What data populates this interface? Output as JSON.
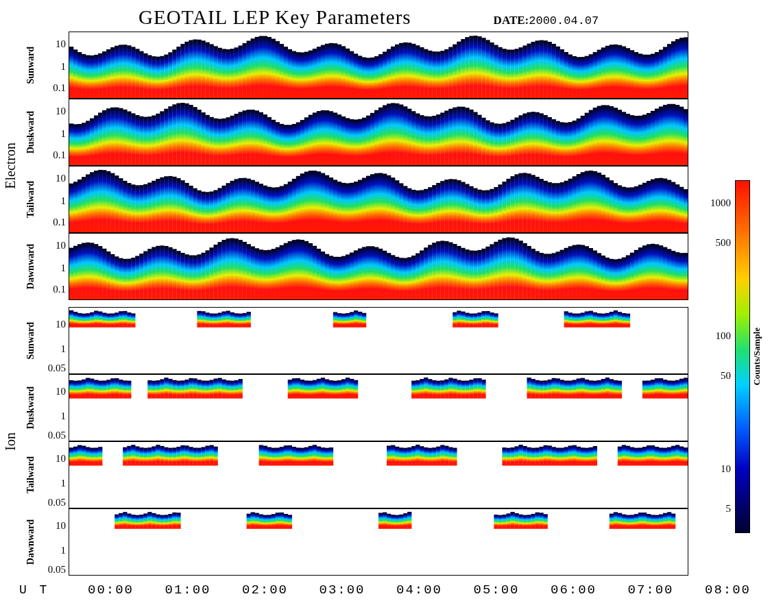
{
  "title": "GEOTAIL LEP Key Parameters",
  "date": {
    "label": "DATE:",
    "value": "2000.04.07"
  },
  "groups": [
    {
      "species": "Electron",
      "kind": "electron",
      "panels": [
        {
          "direction": "Sunward",
          "yticks": [
            "10",
            "1",
            "0.1"
          ]
        },
        {
          "direction": "Duskward",
          "yticks": [
            "10",
            "1",
            "0.1"
          ]
        },
        {
          "direction": "Tailward",
          "yticks": [
            "10",
            "1",
            "0.1"
          ]
        },
        {
          "direction": "Dawnward",
          "yticks": [
            "10",
            "1",
            "0.1"
          ]
        }
      ]
    },
    {
      "species": "Ion",
      "kind": "ion",
      "panels": [
        {
          "direction": "Sunward",
          "yticks": [
            "10",
            "1",
            "0.05"
          ]
        },
        {
          "direction": "Duskward",
          "yticks": [
            "10",
            "1",
            "0.05"
          ]
        },
        {
          "direction": "Tailward",
          "yticks": [
            "10",
            "1",
            "0.05"
          ]
        },
        {
          "direction": "Dawnward",
          "yticks": [
            "10",
            "1",
            "0.05"
          ]
        }
      ]
    }
  ],
  "x_axis": {
    "label": "U T",
    "ticks": [
      "00:00",
      "01:00",
      "02:00",
      "03:00",
      "04:00",
      "05:00",
      "06:00",
      "07:00",
      "08:00"
    ]
  },
  "colorbar": {
    "label": "Counts/Sample",
    "ticks": [
      "1000",
      "500",
      "100",
      "50",
      "10",
      "5"
    ]
  }
}
